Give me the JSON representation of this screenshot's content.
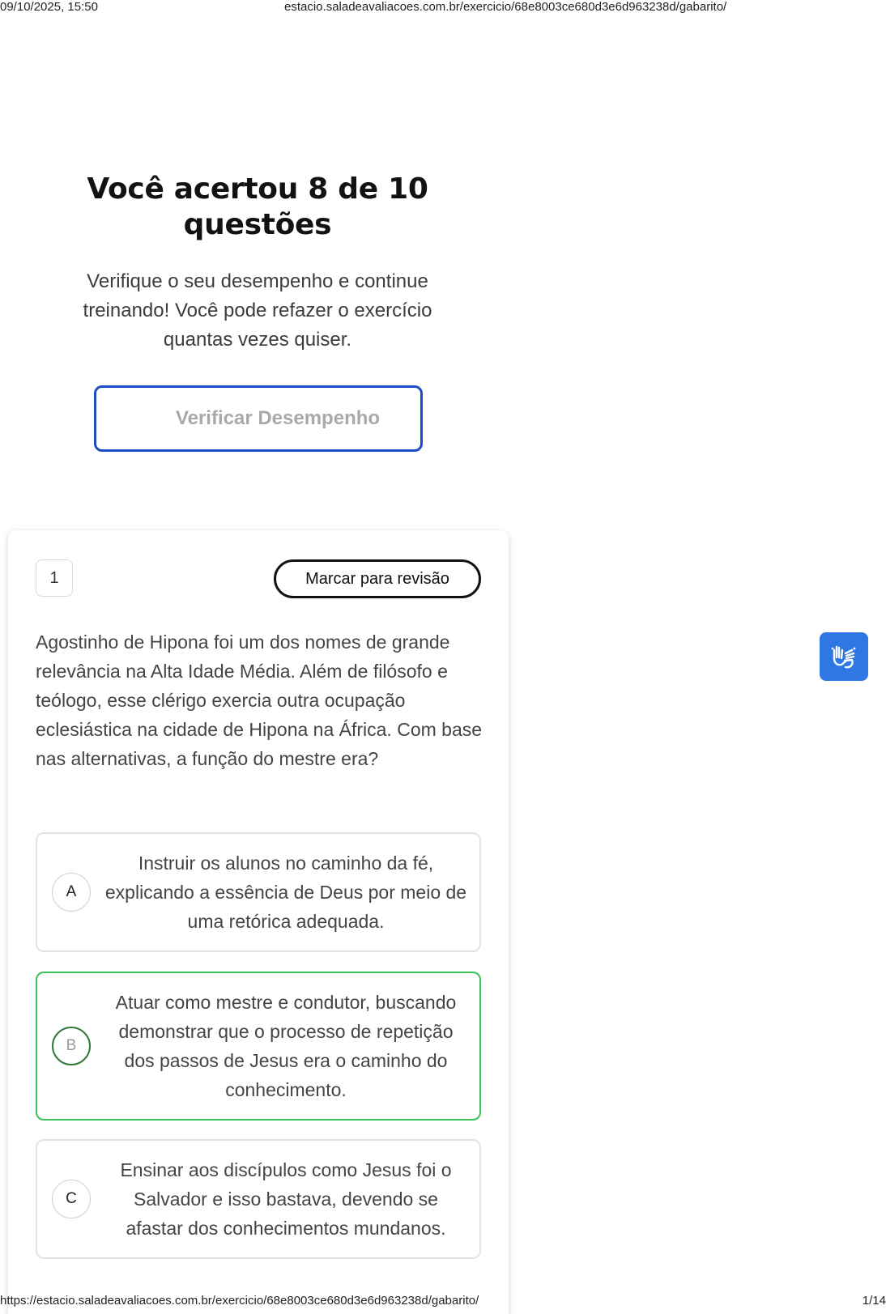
{
  "print_header": {
    "datetime": "09/10/2025, 15:50",
    "title": "estacio.saladeavaliacoes.com.br/exercicio/68e8003ce680d3e6d963238d/gabarito/"
  },
  "result": {
    "title": "Você acertou 8 de 10 questões",
    "subtitle": "Verifique o seu desempenho e continue treinando! Você pode refazer o exercício quantas vezes quiser.",
    "verify_button_label": "Verificar Desempenho"
  },
  "question": {
    "number": "1",
    "review_button_label": "Marcar para revisão",
    "text": "Agostinho de Hipona foi um dos nomes de grande relevância na Alta Idade Média. Além de filósofo e teólogo, esse clérigo exercia outra ocupação eclesiástica na cidade de Hipona na África. Com base nas alternativas, a função do mestre era?",
    "options": [
      {
        "letter": "A",
        "text": "Instruir os alunos no caminho da fé, explicando a essência de Deus por meio de uma retórica adequada.",
        "state": "default"
      },
      {
        "letter": "B",
        "text": "Atuar como mestre e condutor, buscando demonstrar que o processo de repetição dos passos de Jesus era o caminho do conhecimento.",
        "state": "correct"
      },
      {
        "letter": "C",
        "text": "Ensinar aos discípulos como Jesus foi o Salvador e isso bastava, devendo se afastar dos conhecimentos mundanos.",
        "state": "default"
      }
    ]
  },
  "accessibility": {
    "icon": "sign-language-hands-icon",
    "color": "#2f78e3"
  },
  "colors": {
    "verify_border": "#1a4fc4",
    "correct_border": "#3bc15a",
    "correct_letter_ring": "#2f7a3a"
  },
  "print_footer": {
    "url": "https://estacio.saladeavaliacoes.com.br/exercicio/68e8003ce680d3e6d963238d/gabarito/",
    "page": "1/14"
  }
}
